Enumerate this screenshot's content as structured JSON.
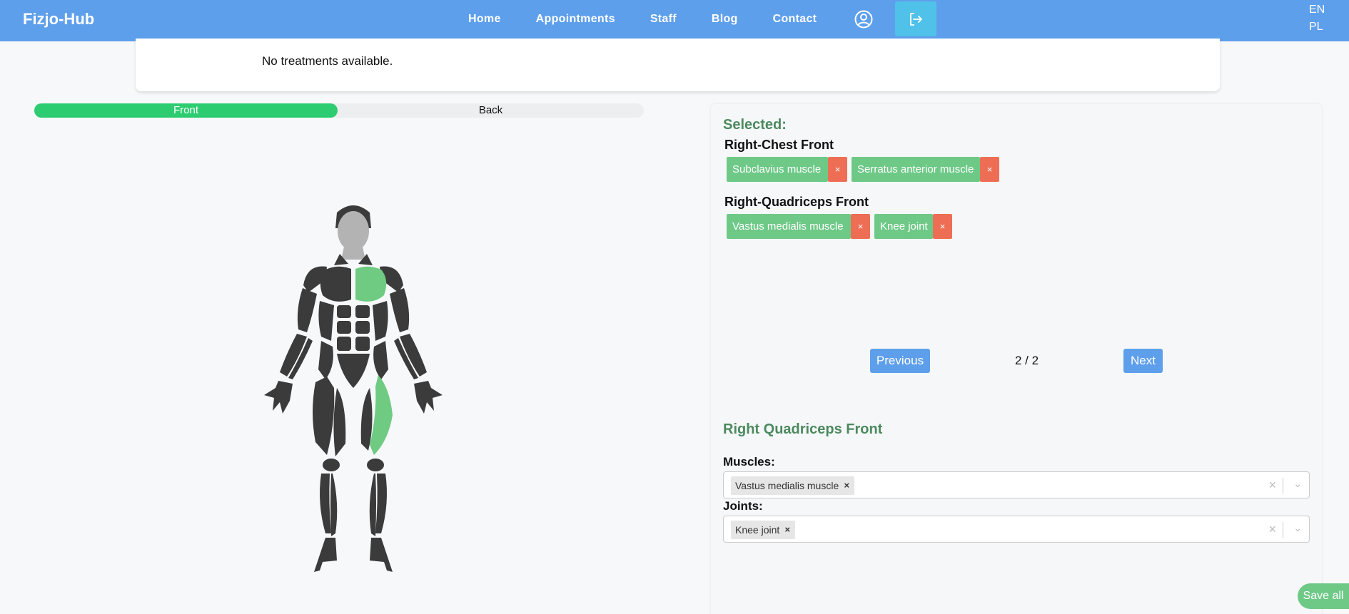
{
  "brand": "Fizjo-Hub",
  "nav": [
    "Home",
    "Appointments",
    "Staff",
    "Blog",
    "Contact"
  ],
  "icons": {
    "profile": "user-circle-icon",
    "logout": "logout-icon"
  },
  "languages": [
    "EN",
    "PL"
  ],
  "treatments_message": "No treatments available.",
  "view_toggle": {
    "front": "Front",
    "back": "Back",
    "active": "Front"
  },
  "selected": {
    "title": "Selected:",
    "groups": [
      {
        "name": "Right-Chest Front",
        "items": [
          "Subclavius muscle",
          "Serratus anterior muscle"
        ]
      },
      {
        "name": "Right-Quadriceps Front",
        "items": [
          "Vastus medialis muscle",
          "Knee joint"
        ]
      }
    ],
    "remove_symbol": "×"
  },
  "pagination": {
    "previous": "Previous",
    "info": "2 / 2",
    "next": "Next"
  },
  "detail": {
    "title": "Right Quadriceps Front",
    "muscles_label": "Muscles:",
    "muscles_value": "Vastus medialis muscle",
    "joints_label": "Joints:",
    "joints_value": "Knee joint"
  },
  "save_label": "Save all",
  "colors": {
    "navbar": "#5e9fec",
    "logout_button": "#50c1e9",
    "toggle_active": "#2ecc71",
    "tag": "#6ec987",
    "tag_remove": "#ee6e55",
    "heading_green": "#4c8a5f",
    "highlight": "#6fcb82",
    "muscle": "#3b3b3b"
  }
}
